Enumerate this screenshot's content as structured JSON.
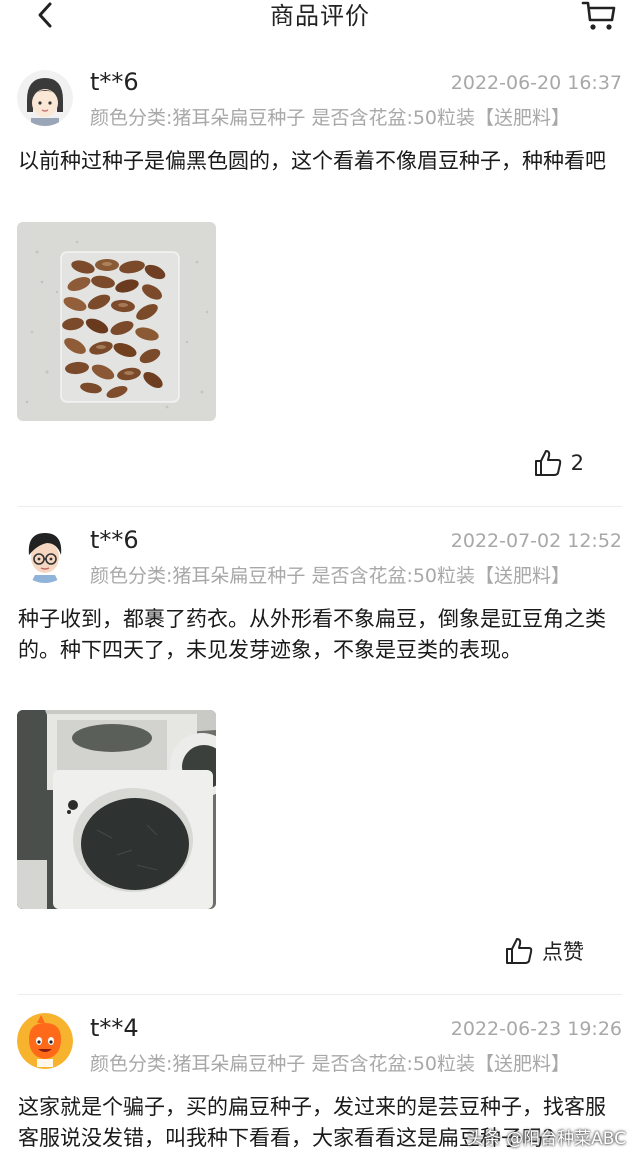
{
  "header": {
    "title": "商品评价",
    "back_icon": "chevron-left-icon",
    "cart_icon": "shopping-cart-icon"
  },
  "reviews": [
    {
      "username": "t**6",
      "timestamp": "2022-06-20 16:37",
      "variant": "颜色分类:猪耳朵扁豆种子 是否含花盆:50粒装【送肥料】",
      "content": "以前种过种子是偏黑色圆的，这个看着不像眉豆种子，种种看吧",
      "like_label": "2"
    },
    {
      "username": "t**6",
      "timestamp": "2022-07-02 12:52",
      "variant": "颜色分类:猪耳朵扁豆种子 是否含花盆:50粒装【送肥料】",
      "content": "种子收到，都裹了药衣。从外形看不象扁豆，倒象是豇豆角之类的。种下四天了，未见发芽迹象，不象是豆类的表现。",
      "like_label": "点赞"
    },
    {
      "username": "t**4",
      "timestamp": "2022-06-23 19:26",
      "variant": "颜色分类:猪耳朵扁豆种子 是否含花盆:50粒装【送肥料】",
      "content": "这家就是个骗子，买的扁豆种子，发过来的是芸豆种子，找客服客服说没发错，叫我种下看看，大家看看这是扁豆种子吗？"
    }
  ],
  "watermark": "头条 @阳台种菜ABC"
}
